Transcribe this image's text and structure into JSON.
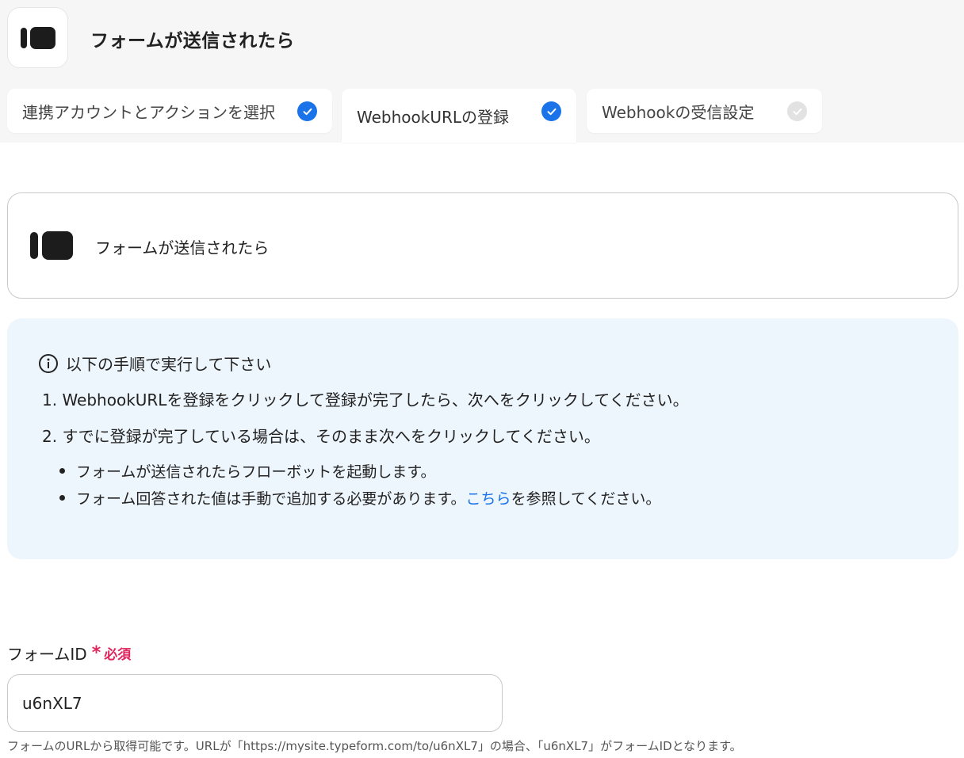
{
  "header": {
    "title": "フォームが送信されたら",
    "app_icon": "typeform-logo-icon"
  },
  "tabs": [
    {
      "label": "連携アカウントとアクションを選択",
      "status": "done"
    },
    {
      "label": "WebhookURLの登録",
      "status": "done",
      "active": true
    },
    {
      "label": "Webhookの受信設定",
      "status": "pending"
    }
  ],
  "trigger": {
    "label": "フォームが送信されたら",
    "icon": "typeform-logo-icon"
  },
  "instructions": {
    "heading": "以下の手順で実行して下さい",
    "icon": "info-icon",
    "steps": [
      "1. WebhookURLを登録をクリックして登録が完了したら、次へをクリックしてください。",
      "2. すでに登録が完了している場合は、そのまま次へをクリックしてください。"
    ],
    "bullets": {
      "b1": "フォームが送信されたらフローボットを起動します。",
      "b2_before": "フォーム回答された値は手動で追加する必要があります。",
      "b2_link": "こちら",
      "b2_after": "を参照してください。"
    }
  },
  "form_id_field": {
    "label": "フォームID",
    "required_mark": "*",
    "required_text": "必須",
    "value": "u6nXL7",
    "help": "フォームのURLから取得可能です。URLが「https://mysite.typeform.com/to/u6nXL7」の場合、「u6nXL7」がフォームIDとなります。"
  },
  "colors": {
    "accent": "#1a73e8",
    "required": "#e0245e",
    "info_bg": "#eef6fd",
    "header_bg": "#f6f6f6"
  }
}
